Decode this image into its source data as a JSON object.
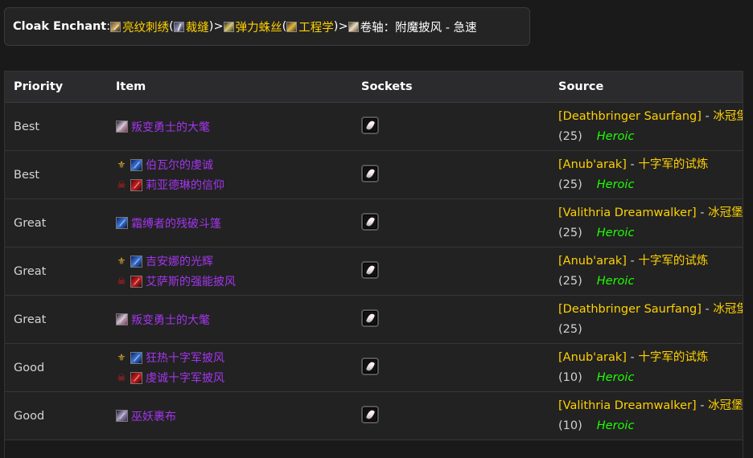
{
  "header": {
    "label": "Cloak Enchant",
    "colon": ":",
    "materials": [
      {
        "icon": "enchanting-icon",
        "name": "亮纹刺绣"
      },
      {
        "icon": "tailoring-icon",
        "name": "裁缝"
      },
      {
        "icon": "spider-thread-icon",
        "name": "弹力蛛丝"
      },
      {
        "icon": "engineering-icon",
        "name": "工程学"
      },
      {
        "icon": "scroll-icon",
        "name": "卷轴：附魔披风 - 急速"
      }
    ],
    "open_paren": " (",
    "close_paren": ")",
    "arrow": " > "
  },
  "table": {
    "headers": {
      "priority": "Priority",
      "item": "Item",
      "sockets": "Sockets",
      "source": "Source"
    },
    "rows": [
      {
        "priority": "Best",
        "items": [
          {
            "faction": "",
            "icon": "cloak-pale",
            "name": "叛变勇士的大氅"
          }
        ],
        "source_boss": "[Deathbringer Saurfang]",
        "source_sep": " - ",
        "source_zone": "冰冠堡垒",
        "source_size": "(25)",
        "heroic": "Heroic"
      },
      {
        "priority": "Best",
        "items": [
          {
            "faction": "alliance",
            "icon": "cloak-blue",
            "name": "伯瓦尔的虔诚"
          },
          {
            "faction": "horde",
            "icon": "cloak-red",
            "name": "莉亚德琳的信仰"
          }
        ],
        "source_boss": "[Anub'arak]",
        "source_sep": " - ",
        "source_zone": "十字军的试炼",
        "source_size": "(25)",
        "heroic": "Heroic"
      },
      {
        "priority": "Great",
        "items": [
          {
            "faction": "",
            "icon": "cloak-blue",
            "name": "霜缚者的残破斗篷"
          }
        ],
        "source_boss": "[Valithria Dreamwalker]",
        "source_sep": " - ",
        "source_zone": "冰冠堡垒",
        "source_size": "(25)",
        "heroic": "Heroic"
      },
      {
        "priority": "Great",
        "items": [
          {
            "faction": "alliance",
            "icon": "cloak-blue",
            "name": "吉安娜的光辉"
          },
          {
            "faction": "horde",
            "icon": "cloak-red",
            "name": "艾萨斯的强能披风"
          }
        ],
        "source_boss": "[Anub'arak]",
        "source_sep": " - ",
        "source_zone": "十字军的试炼",
        "source_size": "(25)",
        "heroic": "Heroic"
      },
      {
        "priority": "Great",
        "items": [
          {
            "faction": "",
            "icon": "cloak-pale",
            "name": "叛变勇士的大氅"
          }
        ],
        "source_boss": "[Deathbringer Saurfang]",
        "source_sep": " - ",
        "source_zone": "冰冠堡垒",
        "source_size": "(25)",
        "heroic": ""
      },
      {
        "priority": "Good",
        "items": [
          {
            "faction": "alliance",
            "icon": "cloak-blue",
            "name": "狂热十字军披风"
          },
          {
            "faction": "horde",
            "icon": "cloak-red",
            "name": "虔诚十字军披风"
          }
        ],
        "source_boss": "[Anub'arak]",
        "source_sep": " - ",
        "source_zone": "十字军的试炼",
        "source_size": "(10)",
        "heroic": "Heroic"
      },
      {
        "priority": "Good",
        "items": [
          {
            "faction": "",
            "icon": "cloak-purple",
            "name": "巫妖裹布"
          }
        ],
        "source_boss": "[Valithria Dreamwalker]",
        "source_sep": " - ",
        "source_zone": "冰冠堡垒",
        "source_size": "(10)",
        "heroic": "Heroic"
      }
    ]
  }
}
